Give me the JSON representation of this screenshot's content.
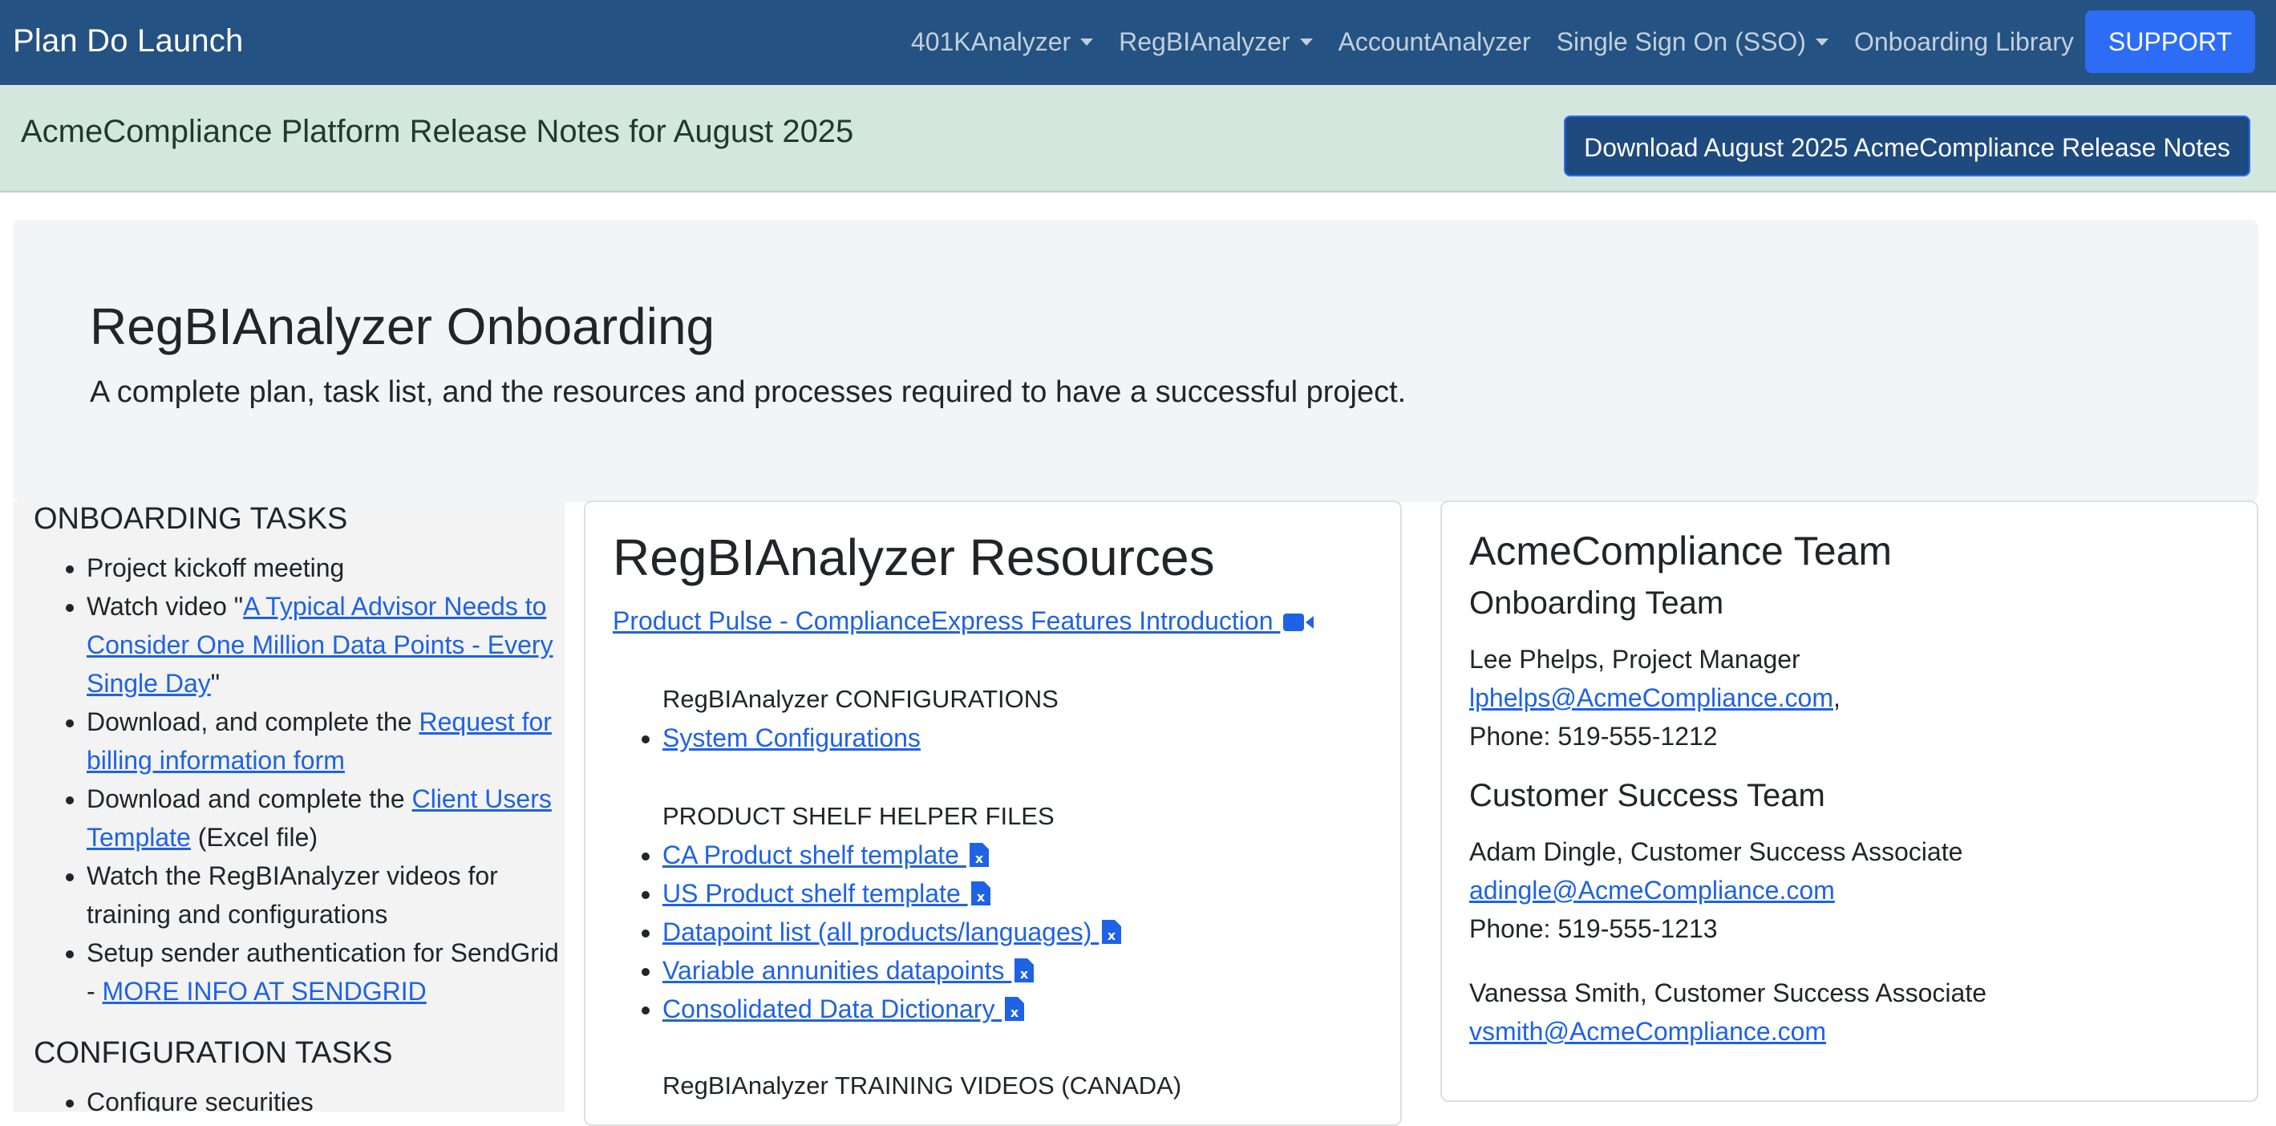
{
  "navbar": {
    "brand": "Plan Do Launch",
    "items": [
      {
        "label": "401KAnalyzer",
        "dropdown": true
      },
      {
        "label": "RegBIAnalyzer",
        "dropdown": true
      },
      {
        "label": "AccountAnalyzer",
        "dropdown": false
      },
      {
        "label": "Single Sign On (SSO)",
        "dropdown": true
      },
      {
        "label": "Onboarding Library",
        "dropdown": false
      }
    ],
    "support_label": "SUPPORT"
  },
  "release": {
    "text": "AcmeCompliance Platform Release Notes for August 2025",
    "button_label": "Download August 2025 AcmeCompliance Release Notes"
  },
  "hero": {
    "title": "RegBIAnalyzer Onboarding",
    "subtitle": "A complete plan, task list, and the resources and processes required to have a successful project."
  },
  "onboarding": {
    "heading": "ONBOARDING TASKS",
    "task1": "Project kickoff meeting",
    "task2_pre": "Watch video \"",
    "task2_link": "A Typical Advisor Needs to Consider One Million Data Points - Every Single Day",
    "task2_post": "\"",
    "task3_pre": "Download, and complete the ",
    "task3_link": "Request for billing information form",
    "task4_pre": "Download and complete the ",
    "task4_link": "Client Users Template",
    "task4_post": " (Excel file)",
    "task5": "Watch the RegBIAnalyzer videos for training and configurations",
    "task6_pre": "Setup sender authentication for SendGrid - ",
    "task6_link": "MORE INFO AT SENDGRID"
  },
  "configuration": {
    "heading": "CONFIGURATION TASKS",
    "first_task_partial": "Configure securities"
  },
  "resources": {
    "title": "RegBIAnalyzer Resources",
    "feature_link": "Product Pulse - ComplianceExpress Features Introduction ",
    "config_label": "RegBIAnalyzer CONFIGURATIONS",
    "config_items": [
      "System Configurations"
    ],
    "shelf_label": "PRODUCT SHELF HELPER FILES",
    "shelf_items": [
      "CA Product shelf template ",
      "US Product shelf template ",
      "Datapoint list (all products/languages) ",
      "Variable annunities datapoints ",
      "Consolidated Data Dictionary "
    ],
    "training_label": "RegBIAnalyzer TRAINING VIDEOS (CANADA)"
  },
  "team": {
    "title": "AcmeCompliance Team",
    "onboarding_heading": "Onboarding Team",
    "lee_name": "Lee Phelps, Project Manager",
    "lee_email": "lphelps@AcmeCompliance.com",
    "lee_comma": ",",
    "lee_phone": "Phone: 519-555-1212",
    "cs_heading": "Customer Success Team",
    "adam_name": "Adam Dingle, Customer Success Associate",
    "adam_email": "adingle@AcmeCompliance.com",
    "adam_phone": "Phone: 519-555-1213",
    "vanessa_name": "Vanessa Smith, Customer Success Associate",
    "vanessa_email": "vsmith@AcmeCompliance.com"
  },
  "colors": {
    "navbar": "#245282",
    "link": "#1e62e6",
    "support_button": "#2d6df6",
    "release_banner": "#d4e7de",
    "release_button": "#1e4a7e"
  },
  "icons": {
    "video": "video-camera-icon",
    "excel": "excel-file-icon",
    "dropdown": "chevron-down-icon"
  }
}
